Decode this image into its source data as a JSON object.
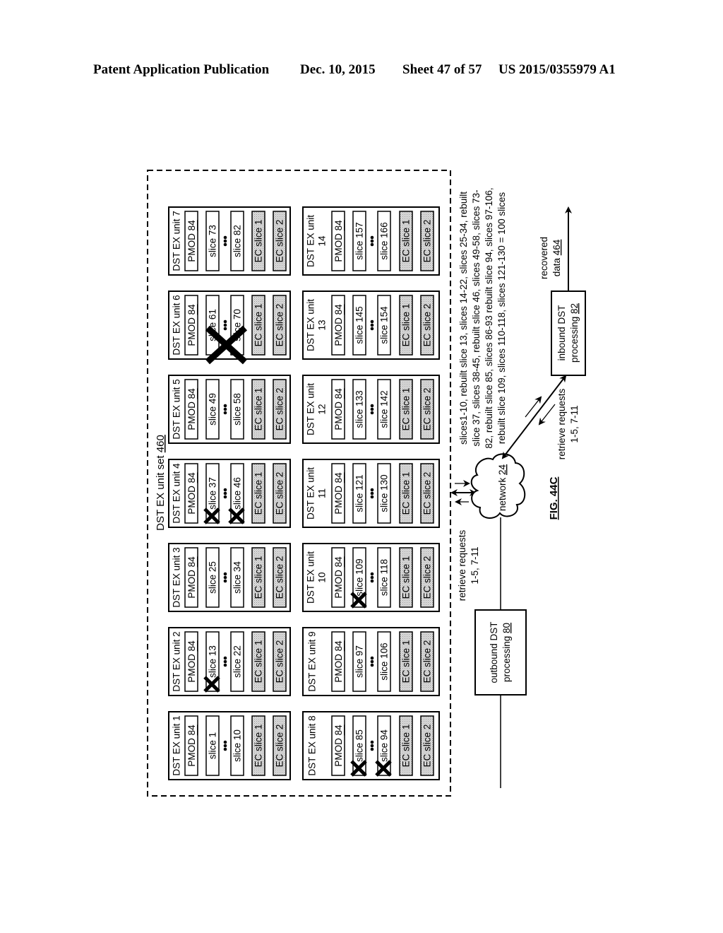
{
  "header": {
    "publication": "Patent Application Publication",
    "date": "Dec. 10, 2015",
    "sheet": "Sheet 47 of 57",
    "number": "US 2015/0355979 A1"
  },
  "figure": {
    "label": "FIG. 44C",
    "unit_set": {
      "label": "DST EX unit set ",
      "ref": "460"
    },
    "pmod": {
      "label": "PMOD ",
      "ref": "84"
    },
    "ec_slices": [
      "EC slice 1",
      "EC  slice 2"
    ],
    "units": [
      {
        "title": "DST EX unit 1",
        "first_slice": "slice 1",
        "last_slice": "slice 10",
        "first_failed": false,
        "last_failed": false
      },
      {
        "title": "DST EX unit 2",
        "first_slice": "slice 13",
        "last_slice": "slice 22",
        "first_failed": true,
        "last_failed": false
      },
      {
        "title": "DST EX unit 3",
        "first_slice": "slice 25",
        "last_slice": "slice 34",
        "first_failed": false,
        "last_failed": false
      },
      {
        "title": "DST EX unit 4",
        "first_slice": "slice 37",
        "last_slice": "slice 46",
        "first_failed": true,
        "last_failed": true
      },
      {
        "title": "DST EX unit 5",
        "first_slice": "slice 49",
        "last_slice": "slice 58",
        "first_failed": false,
        "last_failed": false
      },
      {
        "title": "DST EX unit 6",
        "first_slice": "slice 61",
        "last_slice": "slice 70",
        "first_failed": false,
        "last_failed": false,
        "unit_failed": true
      },
      {
        "title": "DST EX unit 7",
        "first_slice": "slice 73",
        "last_slice": "slice 82",
        "first_failed": false,
        "last_failed": false
      },
      {
        "title": "DST EX unit 8",
        "first_slice": "slice 85",
        "last_slice": "slice 94",
        "first_failed": true,
        "last_failed": true
      },
      {
        "title": "DST EX unit 9",
        "first_slice": "slice 97",
        "last_slice": "slice 106",
        "first_failed": false,
        "last_failed": false
      },
      {
        "title": "DST EX unit",
        "title2": "10",
        "first_slice": "slice 109",
        "last_slice": "slice 118",
        "first_failed": true,
        "last_failed": false
      },
      {
        "title": "DST EX unit",
        "title2": "11",
        "first_slice": "slice 121",
        "last_slice": "slice 130",
        "first_failed": false,
        "last_failed": false
      },
      {
        "title": "DST EX unit",
        "title2": "12",
        "first_slice": "slice 133",
        "last_slice": "slice 142",
        "first_failed": false,
        "last_failed": false
      },
      {
        "title": "DST EX unit",
        "title2": "13",
        "first_slice": "slice 145",
        "last_slice": "slice 154",
        "first_failed": false,
        "last_failed": false
      },
      {
        "title": "DST EX unit",
        "title2": "14",
        "first_slice": "slice 157",
        "last_slice": "slice 166",
        "first_failed": false,
        "last_failed": false
      }
    ],
    "network": {
      "label": "network ",
      "ref": "24"
    },
    "outbound": {
      "line1": "outbound DST",
      "line2": "processing ",
      "ref": "80"
    },
    "inbound": {
      "line1": "inbound DST",
      "line2": "processing ",
      "ref": "82"
    },
    "recovered": {
      "line1": "recovered",
      "line2": "data ",
      "ref": "464"
    },
    "retrieve_requests_left": [
      "retrieve requests",
      "1-5, 7-11"
    ],
    "retrieve_requests_right": [
      "retrieve requests",
      "1-5, 7-11"
    ],
    "slices_summary": [
      "slices1-10, rebuilt slice 13, slices 14-22,  slices 25-34, rebuilt",
      "slice 37, slices 38-45, rebuilt slice 46, slices 49-58, slices 73-",
      "82, rebuilt slice 85, slices 86-93 rebuilt slice 94, slices 97-106,",
      "rebuilt slice 109, slices 110-118, slices 121-130 = 100 slices"
    ],
    "colors": {
      "line": "#000000",
      "ec_fill": "#cfcfcf",
      "background": "#ffffff"
    }
  }
}
